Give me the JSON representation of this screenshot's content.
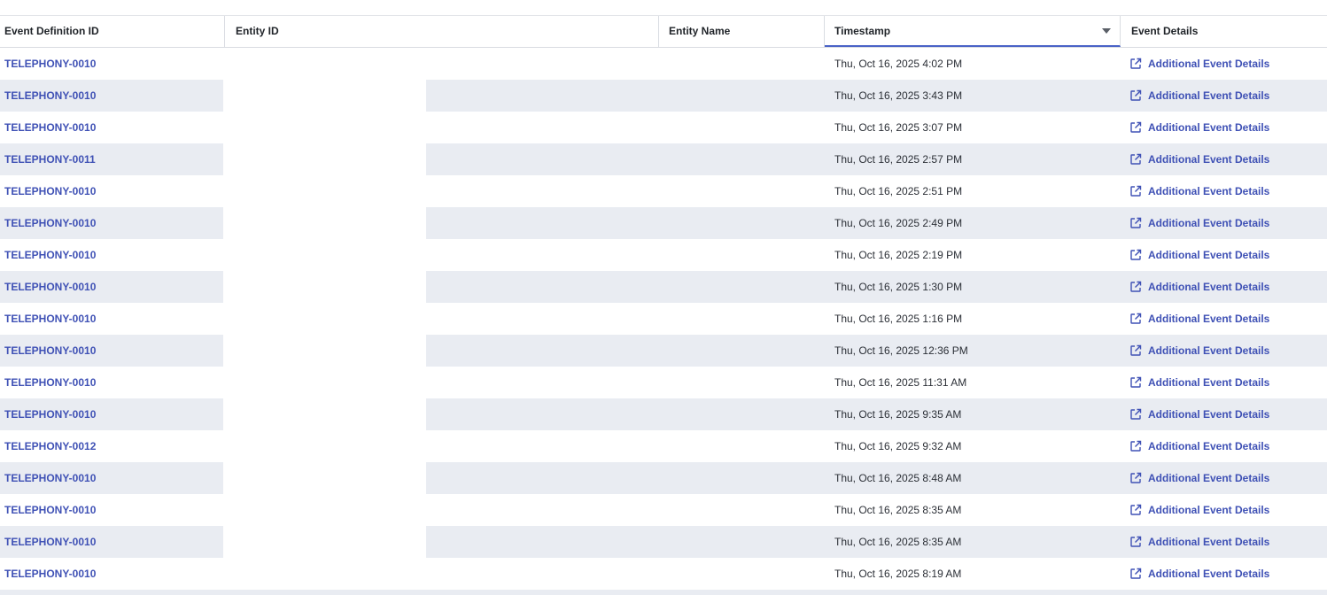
{
  "table": {
    "columns": {
      "event_definition_id": "Event Definition ID",
      "entity_id": "Entity ID",
      "entity_name": "Entity Name",
      "timestamp": "Timestamp",
      "event_details": "Event Details"
    },
    "sorted_column": "timestamp",
    "sort_direction": "descending",
    "rows": [
      {
        "event_definition_id": "TELEPHONY-0010",
        "entity_id": "",
        "entity_name": "",
        "timestamp": "Thu, Oct 16, 2025 4:02 PM",
        "details_label": "Additional Event Details"
      },
      {
        "event_definition_id": "TELEPHONY-0010",
        "entity_id": "",
        "entity_name": "",
        "timestamp": "Thu, Oct 16, 2025 3:43 PM",
        "details_label": "Additional Event Details"
      },
      {
        "event_definition_id": "TELEPHONY-0010",
        "entity_id": "",
        "entity_name": "",
        "timestamp": "Thu, Oct 16, 2025 3:07 PM",
        "details_label": "Additional Event Details"
      },
      {
        "event_definition_id": "TELEPHONY-0011",
        "entity_id": "",
        "entity_name": "",
        "timestamp": "Thu, Oct 16, 2025 2:57 PM",
        "details_label": "Additional Event Details"
      },
      {
        "event_definition_id": "TELEPHONY-0010",
        "entity_id": "",
        "entity_name": "",
        "timestamp": "Thu, Oct 16, 2025 2:51 PM",
        "details_label": "Additional Event Details"
      },
      {
        "event_definition_id": "TELEPHONY-0010",
        "entity_id": "",
        "entity_name": "",
        "timestamp": "Thu, Oct 16, 2025 2:49 PM",
        "details_label": "Additional Event Details"
      },
      {
        "event_definition_id": "TELEPHONY-0010",
        "entity_id": "",
        "entity_name": "",
        "timestamp": "Thu, Oct 16, 2025 2:19 PM",
        "details_label": "Additional Event Details"
      },
      {
        "event_definition_id": "TELEPHONY-0010",
        "entity_id": "",
        "entity_name": "",
        "timestamp": "Thu, Oct 16, 2025 1:30 PM",
        "details_label": "Additional Event Details"
      },
      {
        "event_definition_id": "TELEPHONY-0010",
        "entity_id": "",
        "entity_name": "",
        "timestamp": "Thu, Oct 16, 2025 1:16 PM",
        "details_label": "Additional Event Details"
      },
      {
        "event_definition_id": "TELEPHONY-0010",
        "entity_id": "",
        "entity_name": "",
        "timestamp": "Thu, Oct 16, 2025 12:36 PM",
        "details_label": "Additional Event Details"
      },
      {
        "event_definition_id": "TELEPHONY-0010",
        "entity_id": "",
        "entity_name": "",
        "timestamp": "Thu, Oct 16, 2025 11:31 AM",
        "details_label": "Additional Event Details"
      },
      {
        "event_definition_id": "TELEPHONY-0010",
        "entity_id": "",
        "entity_name": "",
        "timestamp": "Thu, Oct 16, 2025 9:35 AM",
        "details_label": "Additional Event Details"
      },
      {
        "event_definition_id": "TELEPHONY-0012",
        "entity_id": "",
        "entity_name": "",
        "timestamp": "Thu, Oct 16, 2025 9:32 AM",
        "details_label": "Additional Event Details"
      },
      {
        "event_definition_id": "TELEPHONY-0010",
        "entity_id": "",
        "entity_name": "",
        "timestamp": "Thu, Oct 16, 2025 8:48 AM",
        "details_label": "Additional Event Details"
      },
      {
        "event_definition_id": "TELEPHONY-0010",
        "entity_id": "",
        "entity_name": "",
        "timestamp": "Thu, Oct 16, 2025 8:35 AM",
        "details_label": "Additional Event Details"
      },
      {
        "event_definition_id": "TELEPHONY-0010",
        "entity_id": "",
        "entity_name": "",
        "timestamp": "Thu, Oct 16, 2025 8:35 AM",
        "details_label": "Additional Event Details"
      },
      {
        "event_definition_id": "TELEPHONY-0010",
        "entity_id": "",
        "entity_name": "",
        "timestamp": "Thu, Oct 16, 2025 8:19 AM",
        "details_label": "Additional Event Details"
      }
    ]
  },
  "icons": {
    "sort": "sort-descending-icon",
    "details": "external-link-icon"
  },
  "colors": {
    "link": "#3f51b5",
    "stripe": "#e9ecf2",
    "sort_underline": "#4a63c7"
  }
}
